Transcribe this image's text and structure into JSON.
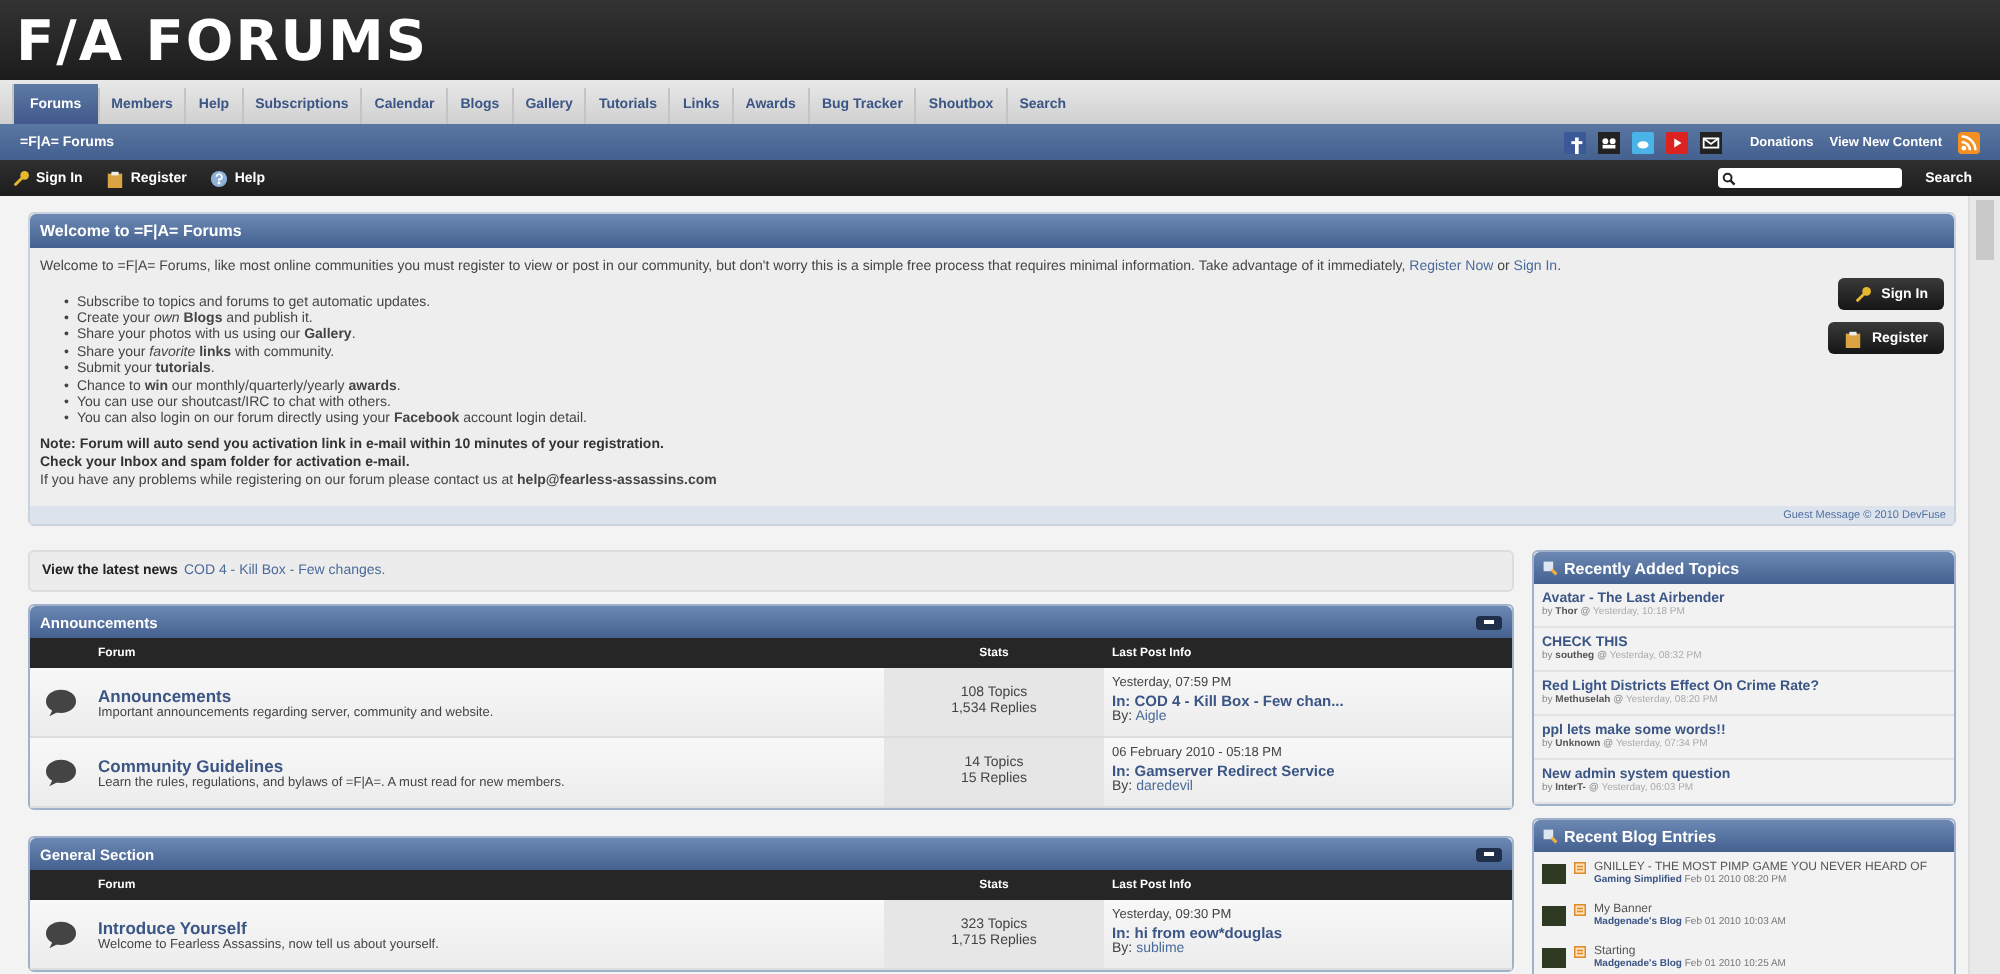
{
  "logo": {
    "text": "F/A FORUMS"
  },
  "nav_tabs": [
    {
      "label": "Forums",
      "selected": true
    },
    {
      "label": "Members",
      "selected": false
    },
    {
      "label": "Help",
      "selected": false
    },
    {
      "label": "Subscriptions",
      "selected": false
    },
    {
      "label": "Calendar",
      "selected": false
    },
    {
      "label": "Blogs",
      "selected": false
    },
    {
      "label": "Gallery",
      "selected": false
    },
    {
      "label": "Tutorials",
      "selected": false
    },
    {
      "label": "Links",
      "selected": false
    },
    {
      "label": "Awards",
      "selected": false
    },
    {
      "label": "Bug Tracker",
      "selected": false
    },
    {
      "label": "Shoutbox",
      "selected": false
    },
    {
      "label": "Search",
      "selected": false
    }
  ],
  "breadcrumb": "=F|A= Forums",
  "top_links": [
    "Donations",
    "View New Content"
  ],
  "user_bar": {
    "links": [
      {
        "kind": "key",
        "label": "Sign In"
      },
      {
        "kind": "register",
        "label": "Register"
      },
      {
        "kind": "help",
        "label": "Help"
      }
    ],
    "search_button": "Search"
  },
  "welcome": {
    "title": "Welcome to =F|A= Forums",
    "intro": [
      {
        "kind": "text",
        "text": "Welcome to =F|A= Forums, like most online communities you must register to view or post in our community, but don't worry this is a simple free process that requires minimal information. Take advantage of it immediately, "
      },
      {
        "kind": "link",
        "text": "Register Now"
      },
      {
        "kind": "text",
        "text": " or "
      },
      {
        "kind": "link",
        "text": "Sign In"
      },
      {
        "kind": "text",
        "text": "."
      }
    ],
    "bullet_marker": "•",
    "bullets": [
      "Subscribe to topics and forums to get automatic updates.",
      "Create your *own* **Blogs** and publish it.",
      "Share your photos with us using our **Gallery**.",
      "Share your *favorite* **links** with community.",
      "Submit your **tutorials**.",
      "Chance to **win** our monthly/quarterly/yearly **awards**.",
      "You can use our shoutcast/IRC to chat with others.",
      "You can also login on our forum directly using your **Facebook** account login detail."
    ],
    "notes": [
      "Note: Forum will auto send you activation link in e-mail within 10 minutes of your registration.",
      "Check your Inbox and spam folder for activation e-mail."
    ],
    "contact": "If you have any problems while registering on our forum please contact us at **help@fearless-assassins.com**",
    "buttons": [
      {
        "kind": "key",
        "label": "Sign In"
      },
      {
        "kind": "register",
        "label": "Register"
      }
    ],
    "footer": "Guest Message © 2010 DevFuse"
  },
  "news": {
    "label": "View the latest news",
    "link": "COD 4 - Kill Box - Few changes."
  },
  "categories": [
    {
      "title": "Announcements",
      "columns": [
        "Forum",
        "Stats",
        "Last Post Info"
      ],
      "forums": [
        {
          "name": "Announcements",
          "description": "Important announcements regarding server, community and website.",
          "topics": "108 Topics",
          "replies": "1,534 Replies",
          "last_date": "Yesterday, 07:59 PM",
          "last_topic": "In: COD 4 - Kill Box - Few chan...",
          "by_label": "By:",
          "author": "Aigle"
        },
        {
          "name": "Community Guidelines",
          "description": "Learn the rules, regulations, and bylaws of =F|A=. A must read for new members.",
          "topics": "14 Topics",
          "replies": "15 Replies",
          "last_date": "06 February 2010 - 05:18 PM",
          "last_topic": "In: Gamserver Redirect Service",
          "by_label": "By:",
          "author": "daredevil"
        }
      ]
    },
    {
      "title": "General Section",
      "columns": [
        "Forum",
        "Stats",
        "Last Post Info"
      ],
      "forums": [
        {
          "name": "Introduce Yourself",
          "description": "Welcome to Fearless Assassins, now tell us about yourself.",
          "topics": "323 Topics",
          "replies": "1,715 Replies",
          "last_date": "Yesterday, 09:30 PM",
          "last_topic": "In: hi from eow*douglas",
          "by_label": "By:",
          "author": "sublime"
        }
      ]
    }
  ],
  "recent_topics": {
    "title": "Recently Added Topics",
    "items": [
      {
        "title": "Avatar - The Last Airbender",
        "by": "by",
        "author": "Thor",
        "at": "@",
        "time": "Yesterday, 10:18 PM"
      },
      {
        "title": "CHECK THIS",
        "by": "by",
        "author": "southeg",
        "at": "@",
        "time": "Yesterday, 08:32 PM"
      },
      {
        "title": "Red Light Districts Effect On Crime Rate?",
        "by": "by",
        "author": "Methuselah",
        "at": "@",
        "time": "Yesterday, 08:20 PM"
      },
      {
        "title": "ppl lets make some words!!",
        "by": "by",
        "author": "Unknown",
        "at": "@",
        "time": "Yesterday, 07:34 PM"
      },
      {
        "title": "New admin system question",
        "by": "by",
        "author": "InterT-",
        "at": "@",
        "time": "Yesterday, 06:03 PM"
      }
    ]
  },
  "recent_blogs": {
    "title": "Recent Blog Entries",
    "items": [
      {
        "title": "GNILLEY - THE MOST PIMP GAME YOU NEVER HEARD OF",
        "blog": "Gaming Simplified",
        "time": "Feb 01 2010 08:20 PM"
      },
      {
        "title": "My Banner",
        "blog": "Madgenade's Blog",
        "time": "Feb 01 2010 10:03 AM"
      },
      {
        "title": "Starting",
        "blog": "Madgenade's Blog",
        "time": "Feb 01 2010 10:25 AM"
      }
    ]
  }
}
